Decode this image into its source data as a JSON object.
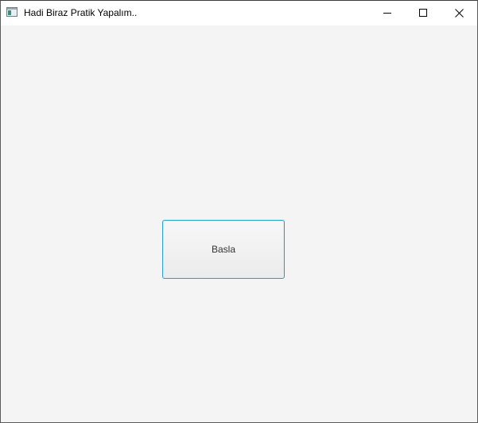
{
  "window": {
    "title": "Hadi Biraz Pratik Yapalım..",
    "icons": {
      "app": "app-window-icon",
      "minimize": "minimize-icon",
      "maximize": "maximize-icon",
      "close": "close-icon"
    }
  },
  "main": {
    "start_button_label": "Basla"
  },
  "colors": {
    "button_border": "#2aa0c8",
    "background": "#f4f4f4"
  }
}
